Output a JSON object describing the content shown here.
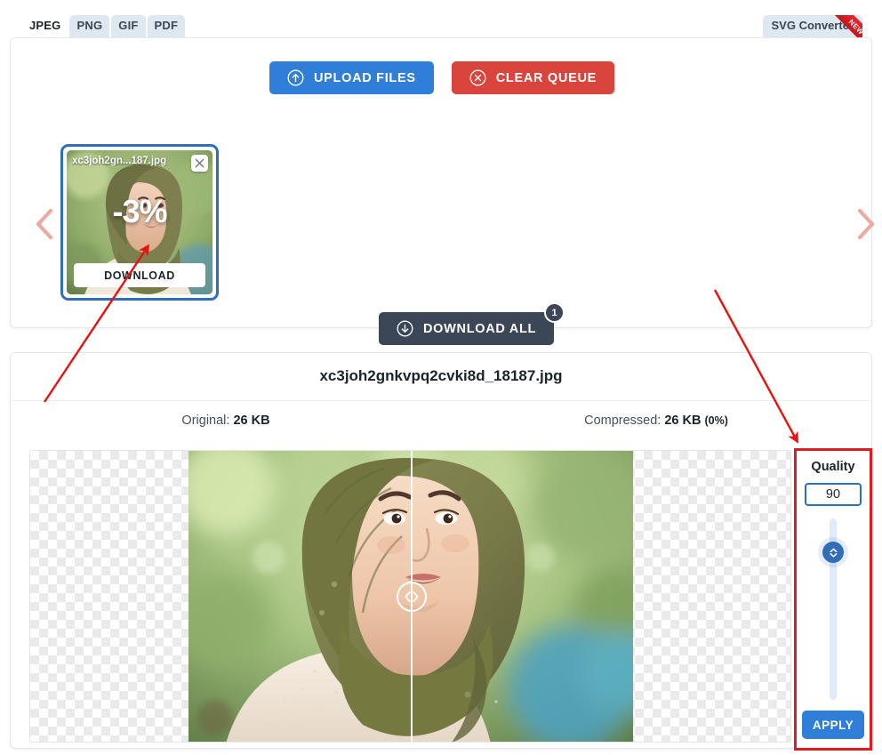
{
  "tabs": {
    "items": [
      {
        "label": "JPEG",
        "active": true
      },
      {
        "label": "PNG",
        "active": false
      },
      {
        "label": "GIF",
        "active": false
      },
      {
        "label": "PDF",
        "active": false
      }
    ],
    "svg_converter_label": "SVG Converter",
    "svg_converter_badge": "NEW"
  },
  "toolbar": {
    "upload_label": "UPLOAD FILES",
    "clear_label": "CLEAR QUEUE",
    "download_all_label": "DOWNLOAD ALL",
    "download_all_count": "1"
  },
  "thumbnail": {
    "filename": "xc3joh2gn...187.jpg",
    "percent": "-3%",
    "download_label": "DOWNLOAD"
  },
  "detail": {
    "title": "xc3joh2gnkvpq2cvki8d_18187.jpg",
    "original_label": "Original:",
    "original_value": "26 KB",
    "compressed_label": "Compressed:",
    "compressed_value": "26 KB",
    "compressed_percent": "(0%)"
  },
  "quality": {
    "label": "Quality",
    "value": "90",
    "apply_label": "APPLY"
  },
  "colors": {
    "primary_blue": "#2f7ed8",
    "danger_red": "#d9453c",
    "dark_navy": "#3b4657",
    "annotation_red": "#e11b22",
    "arrow_salmon": "#eda9a2",
    "card_border_blue": "#2f6fba"
  }
}
